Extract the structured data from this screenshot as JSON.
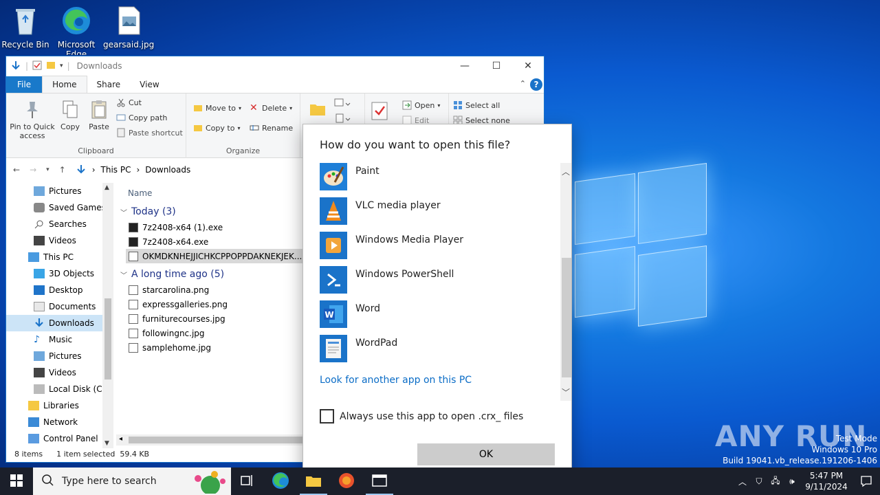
{
  "desktop": {
    "icons": [
      {
        "label": "Recycle Bin"
      },
      {
        "label": "Microsoft Edge"
      },
      {
        "label": "gearsaid.jpg"
      }
    ]
  },
  "explorer": {
    "title": "Downloads",
    "controls": {
      "minimize": "—",
      "maximize": "☐",
      "close": "✕"
    },
    "tabs": {
      "file": "File",
      "home": "Home",
      "share": "Share",
      "view": "View"
    },
    "ribbon": {
      "pin": "Pin to Quick access",
      "copy": "Copy",
      "paste": "Paste",
      "cut": "Cut",
      "copy_path": "Copy path",
      "paste_shortcut": "Paste shortcut",
      "clipboard_label": "Clipboard",
      "move_to": "Move to",
      "copy_to": "Copy to",
      "delete": "Delete",
      "rename": "Rename",
      "organize_label": "Organize",
      "open": "Open",
      "edit": "Edit",
      "select_all": "Select all",
      "select_none": "Select none"
    },
    "address": {
      "segments": [
        "This PC",
        "Downloads"
      ]
    },
    "nav": [
      {
        "label": "Pictures",
        "indent": 2
      },
      {
        "label": "Saved Games",
        "indent": 2
      },
      {
        "label": "Searches",
        "indent": 2
      },
      {
        "label": "Videos",
        "indent": 2
      },
      {
        "label": "This PC",
        "indent": 1
      },
      {
        "label": "3D Objects",
        "indent": 2
      },
      {
        "label": "Desktop",
        "indent": 2
      },
      {
        "label": "Documents",
        "indent": 2
      },
      {
        "label": "Downloads",
        "indent": 2,
        "selected": true
      },
      {
        "label": "Music",
        "indent": 2
      },
      {
        "label": "Pictures",
        "indent": 2
      },
      {
        "label": "Videos",
        "indent": 2
      },
      {
        "label": "Local Disk (C:)",
        "indent": 2
      },
      {
        "label": "Libraries",
        "indent": 1
      },
      {
        "label": "Network",
        "indent": 1
      },
      {
        "label": "Control Panel",
        "indent": 1
      }
    ],
    "column_name": "Name",
    "groups": [
      {
        "title": "Today (3)",
        "files": [
          {
            "name": "7z2408-x64 (1).exe",
            "type": "exe"
          },
          {
            "name": "7z2408-x64.exe",
            "type": "exe"
          },
          {
            "name": "OKMDKNHEJJICHKCPPOPPDAKNEKJEK...",
            "type": "doc",
            "selected": true
          }
        ]
      },
      {
        "title": "A long time ago (5)",
        "files": [
          {
            "name": "starcarolina.png",
            "type": "img"
          },
          {
            "name": "expressgalleries.png",
            "type": "img"
          },
          {
            "name": "furniturecourses.jpg",
            "type": "img"
          },
          {
            "name": "followingnc.jpg",
            "type": "img"
          },
          {
            "name": "samplehome.jpg",
            "type": "img"
          }
        ]
      }
    ],
    "status": {
      "items": "8 items",
      "selected": "1 item selected",
      "size": "59.4 KB"
    }
  },
  "dialog": {
    "title": "How do you want to open this file?",
    "apps": [
      {
        "name": "Paint",
        "icon": "paint-icon",
        "color": "#1e7fd8"
      },
      {
        "name": "VLC media player",
        "icon": "vlc-icon",
        "color": "#1a73c9"
      },
      {
        "name": "Windows Media Player",
        "icon": "wmp-icon",
        "color": "#1a73c9"
      },
      {
        "name": "Windows PowerShell",
        "icon": "powershell-icon",
        "color": "#1a73c9"
      },
      {
        "name": "Word",
        "icon": "word-icon",
        "color": "#1a73c9"
      },
      {
        "name": "WordPad",
        "icon": "wordpad-icon",
        "color": "#1a73c9"
      }
    ],
    "look_link": "Look for another app on this PC",
    "always_label": "Always use this app to open .crx_ files",
    "ok": "OK"
  },
  "watermark": {
    "brand": "ANY RUN"
  },
  "testmode": {
    "line1": "Test Mode",
    "line2": "Windows 10 Pro",
    "line3": "Build 19041.vb_release.191206-1406"
  },
  "taskbar": {
    "search_placeholder": "Type here to search",
    "time": "5:47 PM",
    "date": "9/11/2024"
  },
  "colors": {
    "accent": "#1979ca",
    "link": "#0a6cc6"
  }
}
